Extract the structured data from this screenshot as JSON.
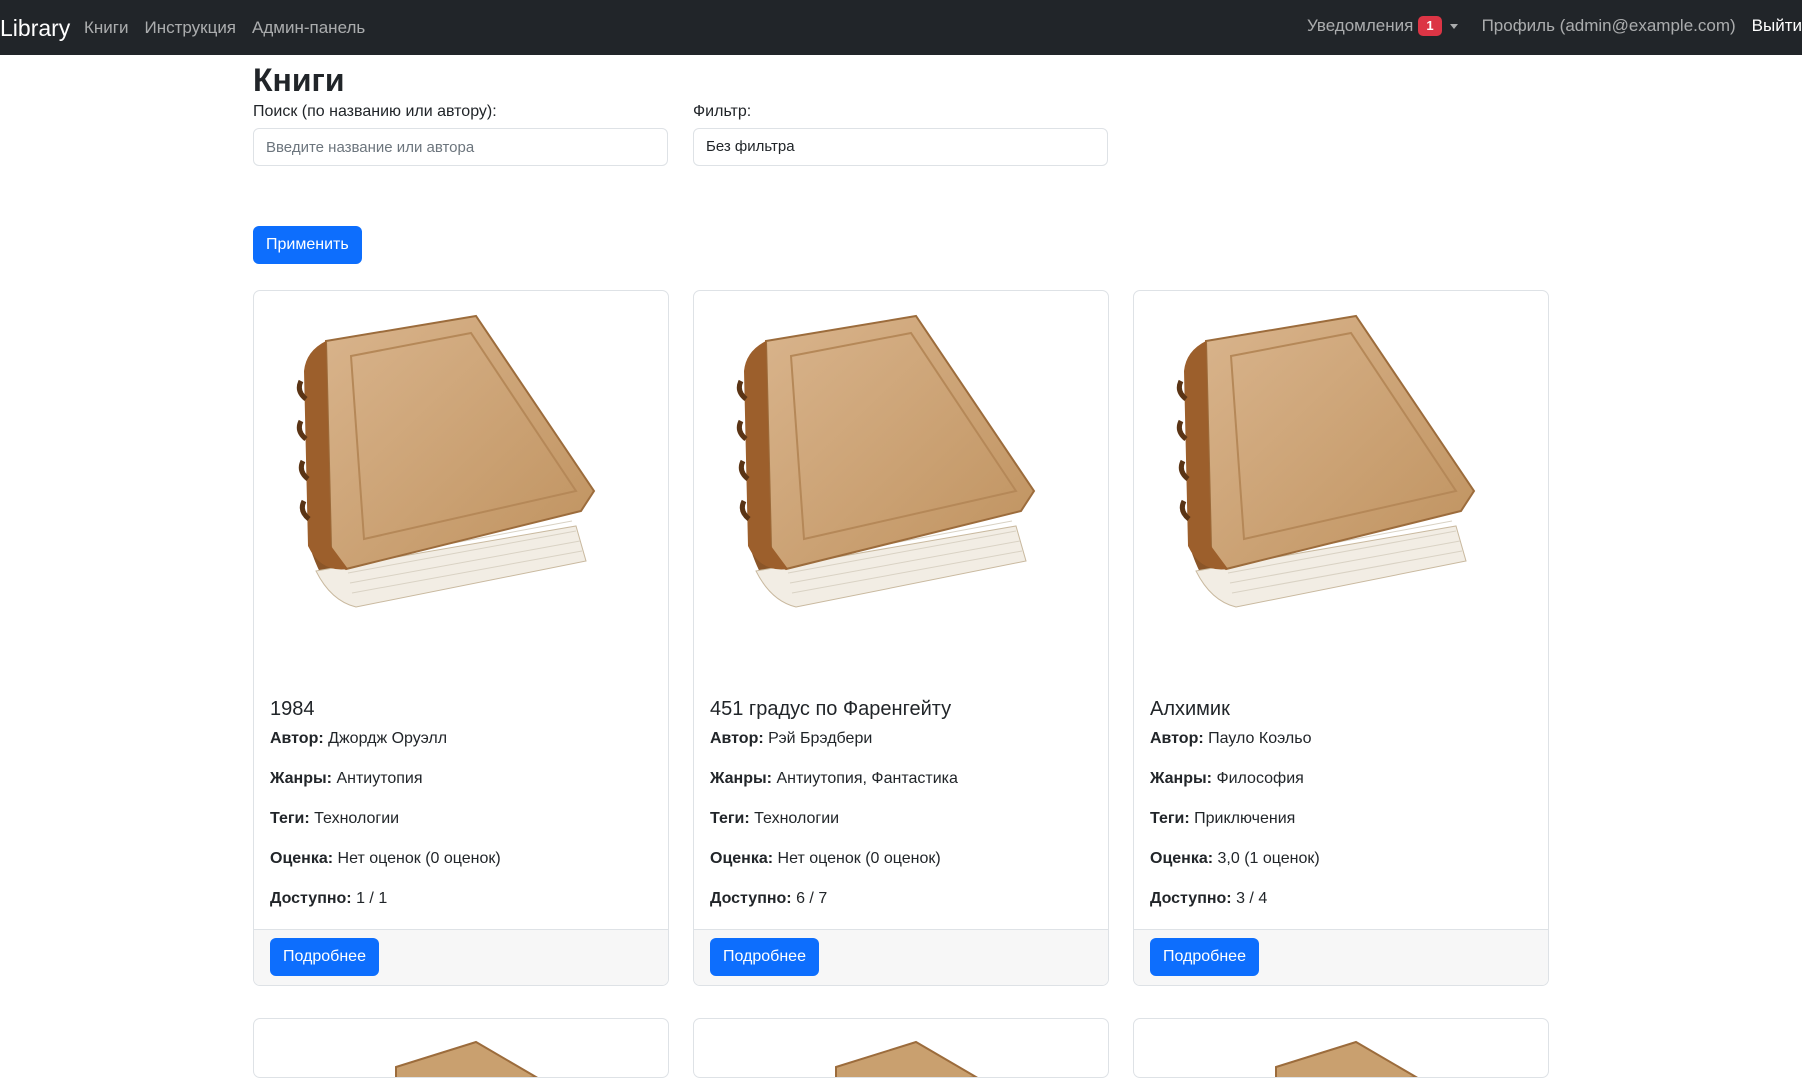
{
  "nav": {
    "brand": "Library",
    "links": [
      "Книги",
      "Инструкция",
      "Админ-панель"
    ],
    "notifications_label": "Уведомления",
    "notifications_count": "1",
    "profile": "Профиль (admin@example.com)",
    "logout": "Выйти"
  },
  "page": {
    "title": "Книги",
    "search_label": "Поиск (по названию или автору):",
    "search_placeholder": "Введите название или автора",
    "filter_label": "Фильтр:",
    "filter_value": "Без фильтра",
    "apply_button": "Применить"
  },
  "labels": {
    "author": "Автор:",
    "genres": "Жанры:",
    "tags": "Теги:",
    "rating": "Оценка:",
    "available": "Доступно:",
    "details_button": "Подробнее"
  },
  "books": [
    {
      "title": "1984",
      "author": "Джордж Оруэлл",
      "genres": "Антиутопия",
      "tags": "Технологии",
      "rating": "Нет оценок (0 оценок)",
      "available": "1 / 1"
    },
    {
      "title": "451 градус по Фаренгейту",
      "author": "Рэй Брэдбери",
      "genres": "Антиутопия, Фантастика",
      "tags": "Технологии",
      "rating": "Нет оценок (0 оценок)",
      "available": "6 / 7"
    },
    {
      "title": "Алхимик",
      "author": "Пауло Коэльо",
      "genres": "Философия",
      "tags": "Приключения",
      "rating": "3,0 (1 оценок)",
      "available": "3 / 4"
    }
  ],
  "colors": {
    "navbar": "#212529",
    "primary": "#0d6efd",
    "badge": "#dc3545"
  }
}
